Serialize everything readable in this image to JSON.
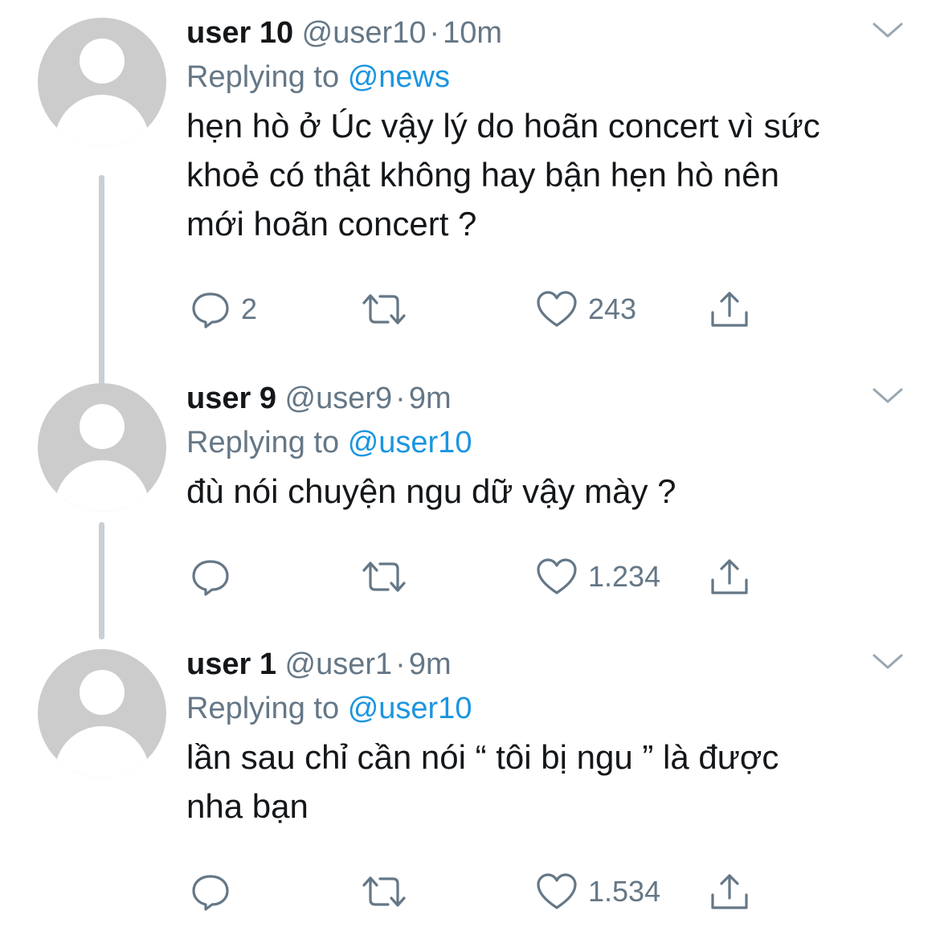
{
  "tweets": [
    {
      "display_name": "user 10",
      "handle": "@user10",
      "separator": "·",
      "time": "10m",
      "replying_label": "Replying to",
      "replying_to": "@news",
      "text_lines": [
        "hẹn hò ở Úc vậy lý do hoãn concert vì sức",
        "khoẻ có thật không hay bận hẹn hò nên",
        "mới hoãn concert ?"
      ],
      "reply_count": "2",
      "retweet_count": "",
      "like_count": "243"
    },
    {
      "display_name": "user 9",
      "handle": "@user9",
      "separator": "·",
      "time": "9m",
      "replying_label": "Replying to",
      "replying_to": "@user10",
      "text_lines": [
        "đù nói chuyện ngu dữ vậy mày ?"
      ],
      "reply_count": "",
      "retweet_count": "",
      "like_count": "1.234"
    },
    {
      "display_name": "user 1",
      "handle": "@user1",
      "separator": "·",
      "time": "9m",
      "replying_label": "Replying to",
      "replying_to": "@user10",
      "text_lines": [
        "lần sau chỉ cần nói “ tôi bị ngu ” là được",
        "nha bạn"
      ],
      "reply_count": "",
      "retweet_count": "",
      "like_count": "1.534"
    }
  ],
  "icons": {
    "reply": "speech-bubble-icon",
    "retweet": "retweet-arrows-icon",
    "like": "heart-outline-icon",
    "share": "share-upload-icon",
    "menu": "chevron-down-icon",
    "avatar": "default-avatar-icon"
  },
  "colors": {
    "text": "#14171a",
    "secondary": "#657786",
    "link": "#1b95e0",
    "avatar_bg": "#cccccc",
    "thread_line": "#c8d0d6",
    "icon": "#657786"
  }
}
